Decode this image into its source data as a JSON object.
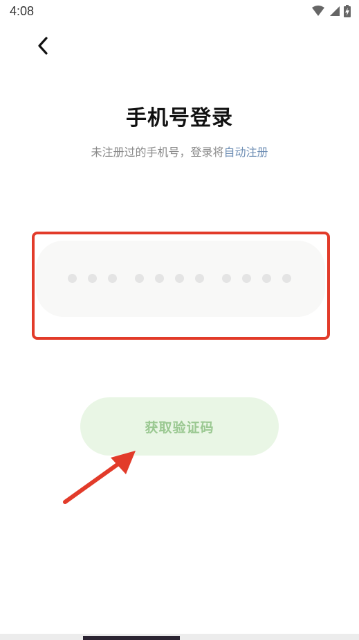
{
  "status_bar": {
    "time": "4:08",
    "icons": [
      "wifi-icon",
      "signal-icon",
      "battery-icon"
    ]
  },
  "header": {
    "back_icon": "chevron-left-icon",
    "title": "手机号登录",
    "subtitle_prefix": "未注册过的手机号，登录将",
    "subtitle_link": "自动注册"
  },
  "form": {
    "phone_placeholder_groups": [
      3,
      4,
      4
    ],
    "get_code_label": "获取验证码"
  },
  "colors": {
    "highlight": "#e23b2a",
    "button_bg": "#e9f6e5",
    "button_text": "#9ac891",
    "link": "#6f8fb5"
  }
}
